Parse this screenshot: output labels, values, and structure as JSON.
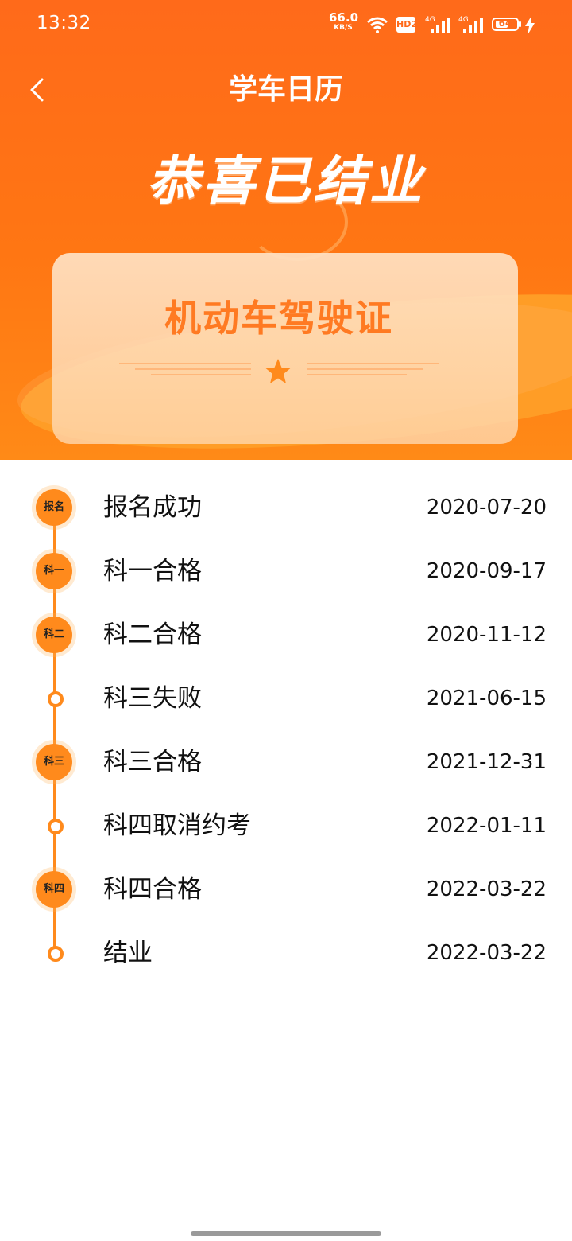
{
  "status_bar": {
    "time": "13:32",
    "net_speed": "66.0",
    "net_speed_unit": "KB/S",
    "hd_label": "HD2",
    "signal_1": "4G",
    "signal_2": "4G",
    "battery": "64",
    "battery_level": 0.64,
    "icons": [
      "wifi-icon",
      "signal-icon",
      "charging-icon"
    ]
  },
  "header": {
    "title": "学车日历",
    "headline": "恭喜已结业",
    "license_title": "机动车驾驶证"
  },
  "colors": {
    "brand": "#ff6a1a",
    "accent": "#ff8a1c",
    "card": "#ffe2c4"
  },
  "timeline": [
    {
      "badge": "报名",
      "label": "报名成功",
      "date": "2020-07-20"
    },
    {
      "badge": "科一",
      "label": "科一合格",
      "date": "2020-09-17"
    },
    {
      "badge": "科二",
      "label": "科二合格",
      "date": "2020-11-12"
    },
    {
      "badge": "",
      "label": "科三失败",
      "date": "2021-06-15"
    },
    {
      "badge": "科三",
      "label": "科三合格",
      "date": "2021-12-31"
    },
    {
      "badge": "",
      "label": "科四取消约考",
      "date": "2022-01-11"
    },
    {
      "badge": "科四",
      "label": "科四合格",
      "date": "2022-03-22"
    },
    {
      "badge": "",
      "label": "结业",
      "date": "2022-03-22"
    }
  ]
}
